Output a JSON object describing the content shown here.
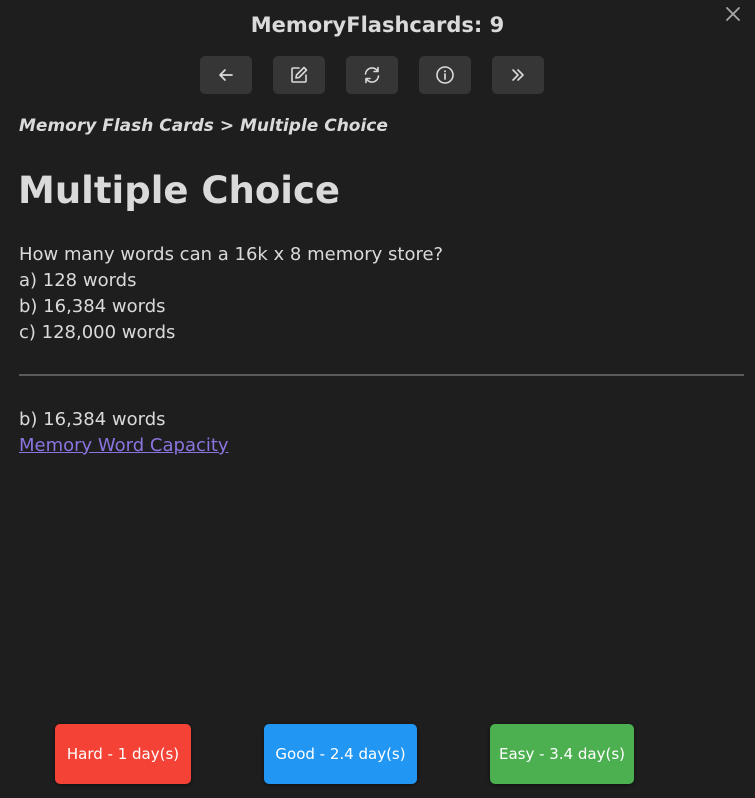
{
  "header": {
    "title": "MemoryFlashcards: 9"
  },
  "toolbar": {
    "buttons": [
      {
        "icon": "arrow-left-icon"
      },
      {
        "icon": "edit-icon"
      },
      {
        "icon": "refresh-icon"
      },
      {
        "icon": "info-icon"
      },
      {
        "icon": "skip-icon"
      }
    ]
  },
  "card": {
    "breadcrumb": "Memory Flash Cards > Multiple Choice",
    "title": "Multiple Choice",
    "question": "How many words can a 16k x 8 memory store?",
    "options": [
      "a) 128 words",
      "b) 16,384 words",
      "c) 128,000 words"
    ],
    "answer": "b) 16,384 words",
    "link_text": "Memory Word Capacity"
  },
  "rating": {
    "hard_label": "Hard - 1 day(s)",
    "good_label": "Good - 2.4 day(s)",
    "easy_label": "Easy - 3.4 day(s)",
    "colors": {
      "hard": "#f44336",
      "good": "#2196f3",
      "easy": "#4caf50"
    }
  }
}
